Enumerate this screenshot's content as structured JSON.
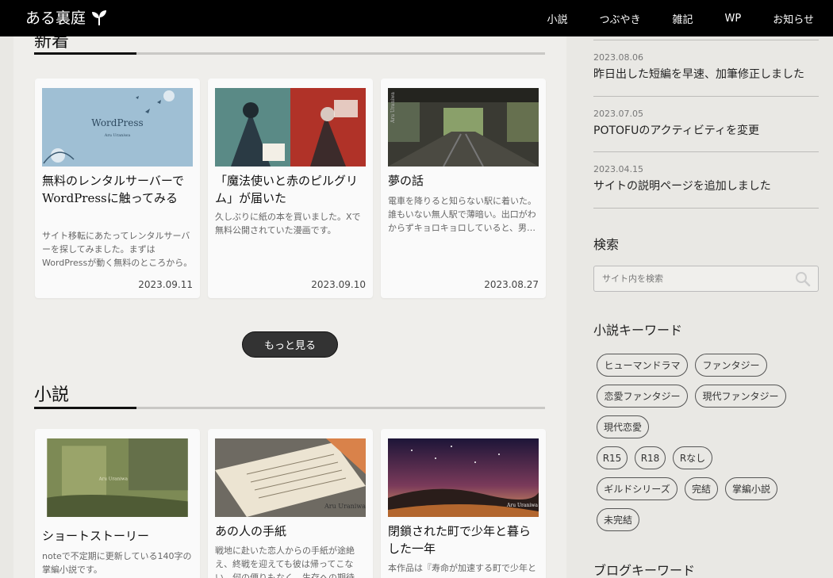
{
  "site": {
    "brand": "ある裏庭"
  },
  "nav": [
    "小説",
    "つぶやき",
    "雑記",
    "WP",
    "お知らせ"
  ],
  "sections": {
    "latest_title": "新着",
    "novels_title": "小説"
  },
  "latest_cards": [
    {
      "title": "無料のレンタルサーバーでWordPressに触ってみる",
      "excerpt": "サイト移転にあたってレンタルサーバーを探してみました。まずはWordPressが動く無料のところから。",
      "date": "2023.09.11",
      "thumb_text": "WordPress",
      "thumb_sub": "Aru Uraniwa"
    },
    {
      "title": "「魔法使いと赤のピルグリム」が届いた",
      "excerpt": "久しぶりに紙の本を買いました。Xで無料公開されていた漫画です。",
      "date": "2023.09.10"
    },
    {
      "title": "夢の話",
      "excerpt": "電車を降りると知らない駅に着いた。誰もいない無人駅で薄暗い。出口がわからずキョロキョロしていると、男…",
      "date": "2023.08.27",
      "thumb_text": "Aru Uraniwa"
    }
  ],
  "more_button": "もっと見る",
  "novel_cards": [
    {
      "title": "ショートストーリー",
      "excerpt": "noteで不定期に更新している140字の掌編小説です。",
      "thumb_text": "Aru Uraniwa"
    },
    {
      "title": "あの人の手紙",
      "excerpt": "戦地に赴いた恋人からの手紙が途絶え、終戦を迎えても彼は帰ってこない。何の便りもなく、生存への期待",
      "thumb_text": "Aru Uraniwa"
    },
    {
      "title": "閉鎖された町で少年と暮らした一年",
      "excerpt": "本作品は『寿命が加速する町で少年と",
      "thumb_text": "Aru Uraniwa"
    }
  ],
  "sidebar": {
    "news": [
      {
        "date": "2023.08.06",
        "title": "昨日出した短編を早速、加筆修正しました"
      },
      {
        "date": "2023.07.05",
        "title": "POTOFUのアクティビティを変更"
      },
      {
        "date": "2023.04.15",
        "title": "サイトの説明ページを追加しました"
      }
    ],
    "search_title": "検索",
    "search_placeholder": "サイト内を検索",
    "novel_keywords_title": "小説キーワード",
    "novel_keywords": [
      "ヒューマンドラマ",
      "ファンタジー",
      "恋愛ファンタジー",
      "現代ファンタジー",
      "現代恋愛",
      "R15",
      "R18",
      "Rなし",
      "ギルドシリーズ",
      "完結",
      "掌編小説",
      "未完結"
    ],
    "blog_keywords_title": "ブログキーワード"
  },
  "colors": {
    "header_bg": "#000000",
    "page_bg": "#e9e8e4",
    "main_bg": "#efeeeb",
    "accent_dark": "#333333"
  }
}
